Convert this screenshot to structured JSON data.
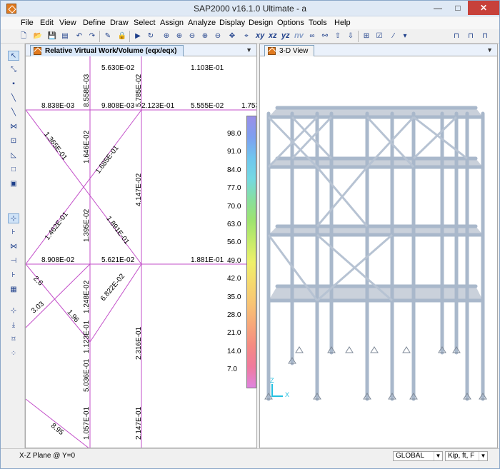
{
  "window": {
    "title": "SAP2000 v16.1.0 Ultimate  - a",
    "minimize_glyph": "—",
    "maximize_glyph": "□",
    "close_glyph": "✕"
  },
  "menu": [
    "File",
    "Edit",
    "View",
    "Define",
    "Draw",
    "Select",
    "Assign",
    "Analyze",
    "Display",
    "Design",
    "Options",
    "Tools",
    "Help"
  ],
  "toolbar": {
    "view_labels": [
      "xy",
      "xz",
      "yz",
      "nv"
    ]
  },
  "left_pane": {
    "tab_title": "Relative Virtual Work/Volume (eqx/eqx)",
    "dropdown_glyph": "▼",
    "labels_horizontal": [
      "5.630E-02",
      "1.103E-01",
      "8.838E-03",
      "9.808E-03",
      "2.123E-01",
      "5.555E-02",
      "1.753",
      "8.908E-02",
      "5.621E-02",
      "1.881E-01"
    ],
    "labels_vertical": [
      "8.558E-03",
      "5.785E-02",
      "1.646E-02",
      "4.147E-02",
      "1.395E-02",
      "1.248E-02",
      "5.036E-01",
      "2.316E-01",
      "1.057E-01",
      "2.147E-01",
      "1.123E-01"
    ],
    "labels_diagonal": [
      "1.365E-01",
      "1.685E-01",
      "1.462E-01",
      "1.891E-01",
      "2.6",
      "6.822E-02",
      "3.03",
      "1.96",
      "8.95"
    ],
    "legend_values": [
      "98.0",
      "91.0",
      "84.0",
      "77.0",
      "70.0",
      "63.0",
      "56.0",
      "49.0",
      "42.0",
      "35.0",
      "28.0",
      "21.0",
      "14.0",
      "7.0"
    ],
    "legend_colors": [
      "#9a8fe8",
      "#7e9ff0",
      "#6fc6ee",
      "#74d9e2",
      "#88df9e",
      "#9ee36f",
      "#c6eb6a",
      "#eef06a",
      "#f6d96e",
      "#f8c474",
      "#f7a77a",
      "#f58a82",
      "#f07a9d",
      "#df83df"
    ]
  },
  "right_pane": {
    "tab_title": "3-D View",
    "dropdown_glyph": "▼",
    "axis_x": "X",
    "axis_z": "Z"
  },
  "status": {
    "plane_text": "X-Z Plane @ Y=0",
    "coord_system": "GLOBAL",
    "units": "Kip, ft, F"
  }
}
